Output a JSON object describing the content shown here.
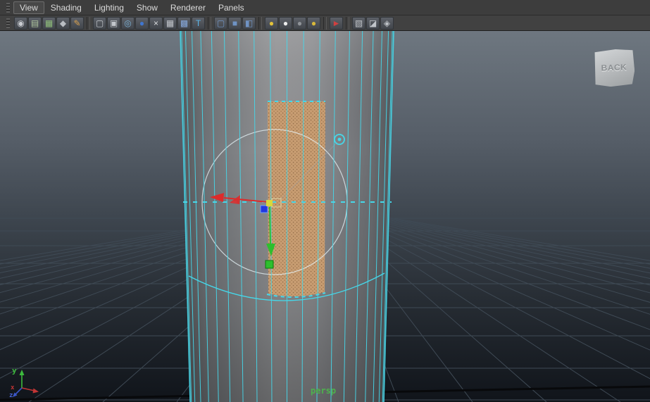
{
  "menu_bar": {
    "items": [
      "View",
      "Shading",
      "Lighting",
      "Show",
      "Renderer",
      "Panels"
    ]
  },
  "toolbar": {
    "items": [
      {
        "name": "camera-icon",
        "glyph": "◉",
        "color": "#c9ccd1"
      },
      {
        "name": "bookmarks-icon",
        "glyph": "▤",
        "color": "#aec59e"
      },
      {
        "name": "image-plane-icon",
        "glyph": "▦",
        "color": "#8fbf7a"
      },
      {
        "name": "view-cube-icon",
        "glyph": "◆",
        "color": "#b9bdc2"
      },
      {
        "name": "grease-pencil-icon",
        "glyph": "✎",
        "color": "#d8a04e"
      },
      {
        "sep": true
      },
      {
        "name": "film-gate-icon",
        "glyph": "▢",
        "color": "#c3c7cc"
      },
      {
        "name": "resolution-gate-icon",
        "glyph": "▣",
        "color": "#c3c7cc"
      },
      {
        "name": "gate-mask-icon",
        "glyph": "◎",
        "color": "#7ab0d4"
      },
      {
        "name": "field-chart-icon",
        "glyph": "●",
        "color": "#3f76d0"
      },
      {
        "name": "safe-action-icon",
        "glyph": "×",
        "color": "#d9dbde"
      },
      {
        "name": "safe-title-icon",
        "glyph": "▦",
        "color": "#c3c7cc"
      },
      {
        "name": "frame-all-icon",
        "glyph": "▩",
        "color": "#86a8dc"
      },
      {
        "name": "textured-display-icon",
        "glyph": "T",
        "color": "#5ab4e8"
      },
      {
        "sep": true
      },
      {
        "name": "wireframe-display-icon",
        "glyph": "▢",
        "color": "#6f93c4"
      },
      {
        "name": "smooth-shade-icon",
        "glyph": "■",
        "color": "#6f93c4"
      },
      {
        "name": "bounding-box-icon",
        "glyph": "◧",
        "color": "#6f93c4"
      },
      {
        "sep": true
      },
      {
        "name": "default-material-icon",
        "glyph": "●",
        "color": "#e2c23a"
      },
      {
        "name": "color-display-icon",
        "glyph": "●",
        "color": "#eceded"
      },
      {
        "name": "no-lights-icon",
        "glyph": "●",
        "color": "#8f9398"
      },
      {
        "name": "all-lights-icon",
        "glyph": "●",
        "color": "#d8b83a"
      },
      {
        "sep": true
      },
      {
        "name": "highlight-selection-icon",
        "glyph": "►",
        "color": "#d04040"
      },
      {
        "sep": true
      },
      {
        "name": "xray-display-icon",
        "glyph": "▧",
        "color": "#c0c4c9"
      },
      {
        "name": "isolate-select-icon",
        "glyph": "◪",
        "color": "#c0c4c9"
      },
      {
        "name": "share-view-icon",
        "glyph": "◈",
        "color": "#c0c4c9"
      }
    ]
  },
  "viewport": {
    "camera_label": "persp",
    "back_sticker_label": "BACK",
    "axis": {
      "x": "x",
      "y": "y",
      "z": "z"
    }
  },
  "colors": {
    "wireframe": "#45d8ea",
    "selection_circle": "#e8f6fa",
    "grid": "#3f4a55",
    "grid_axis": "#08090b",
    "manip_x": "#dd2b2b",
    "manip_y": "#2ebf2e",
    "manip_z": "#2238e0",
    "manip_center": "#d8d83a",
    "face_texture_base": "#c89d72",
    "face_texture_dot": "#936e49",
    "bg_top": "#6e7780",
    "bg_bottom": "#10141a"
  }
}
